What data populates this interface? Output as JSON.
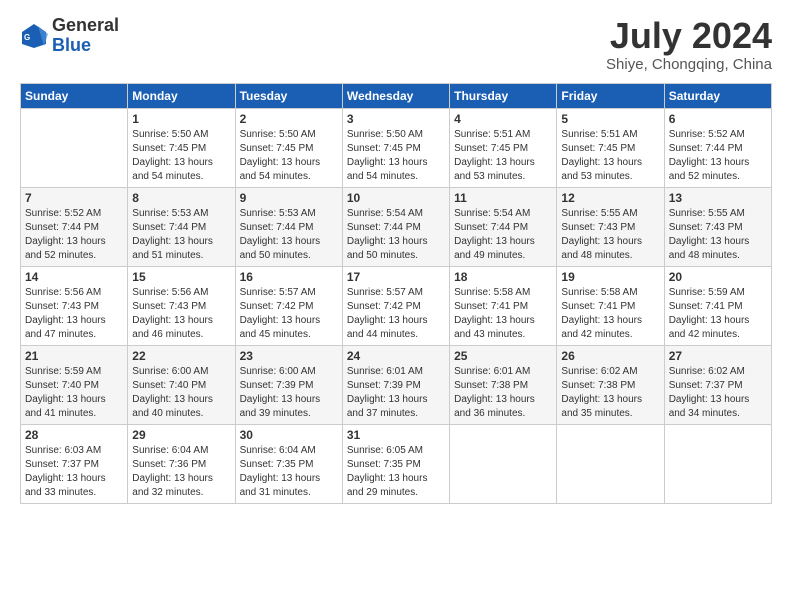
{
  "logo": {
    "general": "General",
    "blue": "Blue"
  },
  "title": {
    "month_year": "July 2024",
    "location": "Shiye, Chongqing, China"
  },
  "weekdays": [
    "Sunday",
    "Monday",
    "Tuesday",
    "Wednesday",
    "Thursday",
    "Friday",
    "Saturday"
  ],
  "weeks": [
    [
      {
        "day": "",
        "info": ""
      },
      {
        "day": "1",
        "info": "Sunrise: 5:50 AM\nSunset: 7:45 PM\nDaylight: 13 hours\nand 54 minutes."
      },
      {
        "day": "2",
        "info": "Sunrise: 5:50 AM\nSunset: 7:45 PM\nDaylight: 13 hours\nand 54 minutes."
      },
      {
        "day": "3",
        "info": "Sunrise: 5:50 AM\nSunset: 7:45 PM\nDaylight: 13 hours\nand 54 minutes."
      },
      {
        "day": "4",
        "info": "Sunrise: 5:51 AM\nSunset: 7:45 PM\nDaylight: 13 hours\nand 53 minutes."
      },
      {
        "day": "5",
        "info": "Sunrise: 5:51 AM\nSunset: 7:45 PM\nDaylight: 13 hours\nand 53 minutes."
      },
      {
        "day": "6",
        "info": "Sunrise: 5:52 AM\nSunset: 7:44 PM\nDaylight: 13 hours\nand 52 minutes."
      }
    ],
    [
      {
        "day": "7",
        "info": "Sunrise: 5:52 AM\nSunset: 7:44 PM\nDaylight: 13 hours\nand 52 minutes."
      },
      {
        "day": "8",
        "info": "Sunrise: 5:53 AM\nSunset: 7:44 PM\nDaylight: 13 hours\nand 51 minutes."
      },
      {
        "day": "9",
        "info": "Sunrise: 5:53 AM\nSunset: 7:44 PM\nDaylight: 13 hours\nand 50 minutes."
      },
      {
        "day": "10",
        "info": "Sunrise: 5:54 AM\nSunset: 7:44 PM\nDaylight: 13 hours\nand 50 minutes."
      },
      {
        "day": "11",
        "info": "Sunrise: 5:54 AM\nSunset: 7:44 PM\nDaylight: 13 hours\nand 49 minutes."
      },
      {
        "day": "12",
        "info": "Sunrise: 5:55 AM\nSunset: 7:43 PM\nDaylight: 13 hours\nand 48 minutes."
      },
      {
        "day": "13",
        "info": "Sunrise: 5:55 AM\nSunset: 7:43 PM\nDaylight: 13 hours\nand 48 minutes."
      }
    ],
    [
      {
        "day": "14",
        "info": "Sunrise: 5:56 AM\nSunset: 7:43 PM\nDaylight: 13 hours\nand 47 minutes."
      },
      {
        "day": "15",
        "info": "Sunrise: 5:56 AM\nSunset: 7:43 PM\nDaylight: 13 hours\nand 46 minutes."
      },
      {
        "day": "16",
        "info": "Sunrise: 5:57 AM\nSunset: 7:42 PM\nDaylight: 13 hours\nand 45 minutes."
      },
      {
        "day": "17",
        "info": "Sunrise: 5:57 AM\nSunset: 7:42 PM\nDaylight: 13 hours\nand 44 minutes."
      },
      {
        "day": "18",
        "info": "Sunrise: 5:58 AM\nSunset: 7:41 PM\nDaylight: 13 hours\nand 43 minutes."
      },
      {
        "day": "19",
        "info": "Sunrise: 5:58 AM\nSunset: 7:41 PM\nDaylight: 13 hours\nand 42 minutes."
      },
      {
        "day": "20",
        "info": "Sunrise: 5:59 AM\nSunset: 7:41 PM\nDaylight: 13 hours\nand 42 minutes."
      }
    ],
    [
      {
        "day": "21",
        "info": "Sunrise: 5:59 AM\nSunset: 7:40 PM\nDaylight: 13 hours\nand 41 minutes."
      },
      {
        "day": "22",
        "info": "Sunrise: 6:00 AM\nSunset: 7:40 PM\nDaylight: 13 hours\nand 40 minutes."
      },
      {
        "day": "23",
        "info": "Sunrise: 6:00 AM\nSunset: 7:39 PM\nDaylight: 13 hours\nand 39 minutes."
      },
      {
        "day": "24",
        "info": "Sunrise: 6:01 AM\nSunset: 7:39 PM\nDaylight: 13 hours\nand 37 minutes."
      },
      {
        "day": "25",
        "info": "Sunrise: 6:01 AM\nSunset: 7:38 PM\nDaylight: 13 hours\nand 36 minutes."
      },
      {
        "day": "26",
        "info": "Sunrise: 6:02 AM\nSunset: 7:38 PM\nDaylight: 13 hours\nand 35 minutes."
      },
      {
        "day": "27",
        "info": "Sunrise: 6:02 AM\nSunset: 7:37 PM\nDaylight: 13 hours\nand 34 minutes."
      }
    ],
    [
      {
        "day": "28",
        "info": "Sunrise: 6:03 AM\nSunset: 7:37 PM\nDaylight: 13 hours\nand 33 minutes."
      },
      {
        "day": "29",
        "info": "Sunrise: 6:04 AM\nSunset: 7:36 PM\nDaylight: 13 hours\nand 32 minutes."
      },
      {
        "day": "30",
        "info": "Sunrise: 6:04 AM\nSunset: 7:35 PM\nDaylight: 13 hours\nand 31 minutes."
      },
      {
        "day": "31",
        "info": "Sunrise: 6:05 AM\nSunset: 7:35 PM\nDaylight: 13 hours\nand 29 minutes."
      },
      {
        "day": "",
        "info": ""
      },
      {
        "day": "",
        "info": ""
      },
      {
        "day": "",
        "info": ""
      }
    ]
  ]
}
